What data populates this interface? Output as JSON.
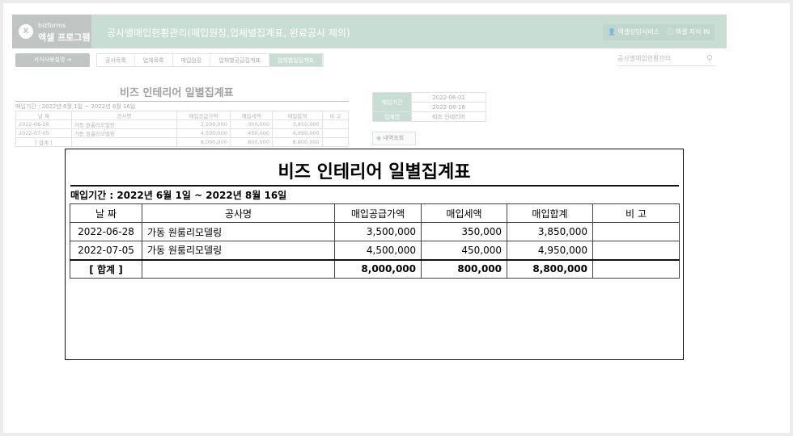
{
  "header": {
    "logo_small": "bizforms",
    "logo_big": "엑셀 프로그램",
    "title": "공사별매입현황관리(매입원장,업체별집계표, 완료공사 제외)",
    "consult_btn": "엑셀상담서비스",
    "knowledge_btn": "엑셀 지식 IN"
  },
  "nav": {
    "guide_btn": "서식사용설명",
    "tabs": [
      "공사목록",
      "업체목록",
      "매입원장",
      "업체별공급집계표",
      "업체별일집계표"
    ],
    "search_placeholder": "공사별매입현황관리"
  },
  "report": {
    "title": "비즈 인테리어 일별집계표",
    "period": "매입기간 : 2022년 6월 1일 ~ 2022년 8월 16일",
    "columns": [
      "날 짜",
      "공사명",
      "매입공급가액",
      "매입세액",
      "매입합계",
      "비 고"
    ],
    "rows": [
      [
        "2022-06-28",
        "가동 원룸리모델링",
        "3,500,000",
        "350,000",
        "3,850,000",
        ""
      ],
      [
        "2022-07-05",
        "가동 원룸리모델링",
        "4,500,000",
        "450,000",
        "4,950,000",
        ""
      ]
    ],
    "total": [
      "[ 합계 ]",
      "",
      "8,000,000",
      "800,000",
      "8,800,000",
      ""
    ]
  },
  "filter": {
    "period_label": "매입기간",
    "start": "2022-06-01",
    "end": "2022-08-16",
    "vendor_label": "업체명",
    "vendor": "비즈 인테리어",
    "query_btn": "내역조회"
  }
}
